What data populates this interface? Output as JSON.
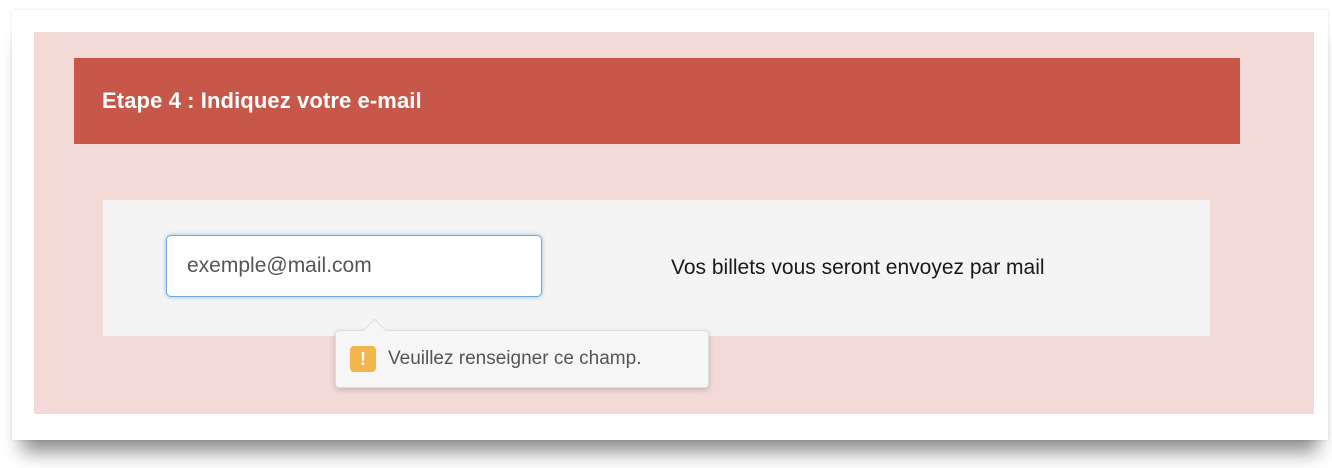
{
  "step": {
    "title": "Etape 4 : Indiquez votre e-mail"
  },
  "email": {
    "placeholder": "exemple@mail.com",
    "value": ""
  },
  "info": {
    "text": "Vos billets vous seront envoyez par mail"
  },
  "validation": {
    "icon": "warning-icon",
    "icon_glyph": "!",
    "message": "Veuillez renseigner ce champ."
  },
  "colors": {
    "header": "#c75849",
    "panel": "#f3dad7",
    "form_box": "#f4f4f4",
    "input_focus": "#6fa9dc",
    "warning": "#f2b64c"
  }
}
